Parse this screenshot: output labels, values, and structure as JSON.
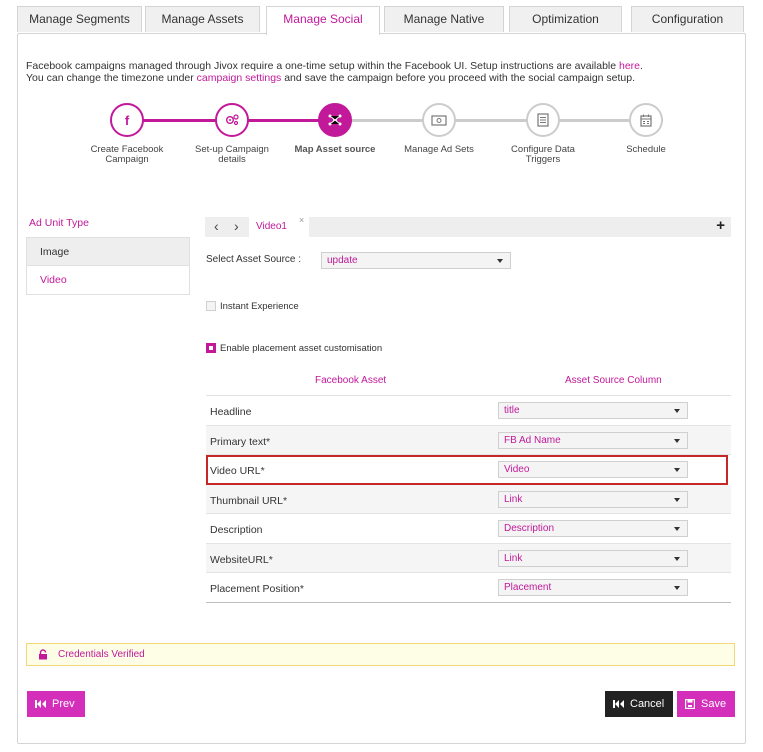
{
  "tabs": [
    {
      "label": "Manage Segments",
      "active": false
    },
    {
      "label": "Manage Assets",
      "active": false
    },
    {
      "label": "Manage Social",
      "active": true
    },
    {
      "label": "Manage Native",
      "active": false
    },
    {
      "label": "Optimization",
      "active": false
    },
    {
      "label": "Configuration",
      "active": false
    }
  ],
  "info": {
    "line1_prefix": "Facebook campaigns managed through Jivox require a one-time setup within the Facebook UI. Setup instructions are available ",
    "line1_link": "here",
    "line1_suffix": ".",
    "line2_prefix": "You can change the timezone under ",
    "line2_link": "campaign settings",
    "line2_suffix": " and save the campaign before you proceed with the social campaign setup."
  },
  "steps": [
    {
      "label_1": "Create Facebook",
      "label_2": "Campaign",
      "icon": "facebook-icon",
      "state": "done"
    },
    {
      "label_1": "Set-up Campaign",
      "label_2": "details",
      "icon": "gear-icon",
      "state": "done"
    },
    {
      "label_1": "Map Asset source",
      "label_2": "",
      "icon": "share-icon",
      "state": "current"
    },
    {
      "label_1": "Manage Ad Sets",
      "label_2": "",
      "icon": "money-icon",
      "state": "todo"
    },
    {
      "label_1": "Configure Data",
      "label_2": "Triggers",
      "icon": "list-icon",
      "state": "todo"
    },
    {
      "label_1": "Schedule",
      "label_2": "",
      "icon": "calendar-icon",
      "state": "todo"
    }
  ],
  "ad_unit": {
    "title": "Ad Unit Type",
    "items": [
      "Image",
      "Video"
    ]
  },
  "asset_tabs": {
    "prev": "<",
    "next": ">",
    "tab_label": "Video1",
    "close": "×",
    "add": "+"
  },
  "asset_source": {
    "label": "Select Asset Source :",
    "value": "update"
  },
  "instant_experience": {
    "label": "Instant Experience",
    "checked": false
  },
  "placement_custom": {
    "label": "Enable placement asset customisation",
    "checked": true
  },
  "mapping": {
    "col_left": "Facebook Asset",
    "col_right": "Asset Source Column",
    "rows": [
      {
        "name": "Headline",
        "value": "title"
      },
      {
        "name": "Primary text*",
        "value": "FB Ad Name"
      },
      {
        "name": "Video URL*",
        "value": "Video"
      },
      {
        "name": "Thumbnail URL*",
        "value": "Link"
      },
      {
        "name": "Description",
        "value": "Description"
      },
      {
        "name": "WebsiteURL*",
        "value": "Link"
      },
      {
        "name": "Placement Position*",
        "value": "Placement"
      }
    ]
  },
  "credentials": {
    "text": "Credentials Verified",
    "icon": "lock-icon"
  },
  "buttons": {
    "prev": "Prev",
    "cancel": "Cancel",
    "save": "Save"
  },
  "colors": {
    "accent": "#c1199a",
    "button": "#d32fba",
    "highlight": "#c62828"
  }
}
